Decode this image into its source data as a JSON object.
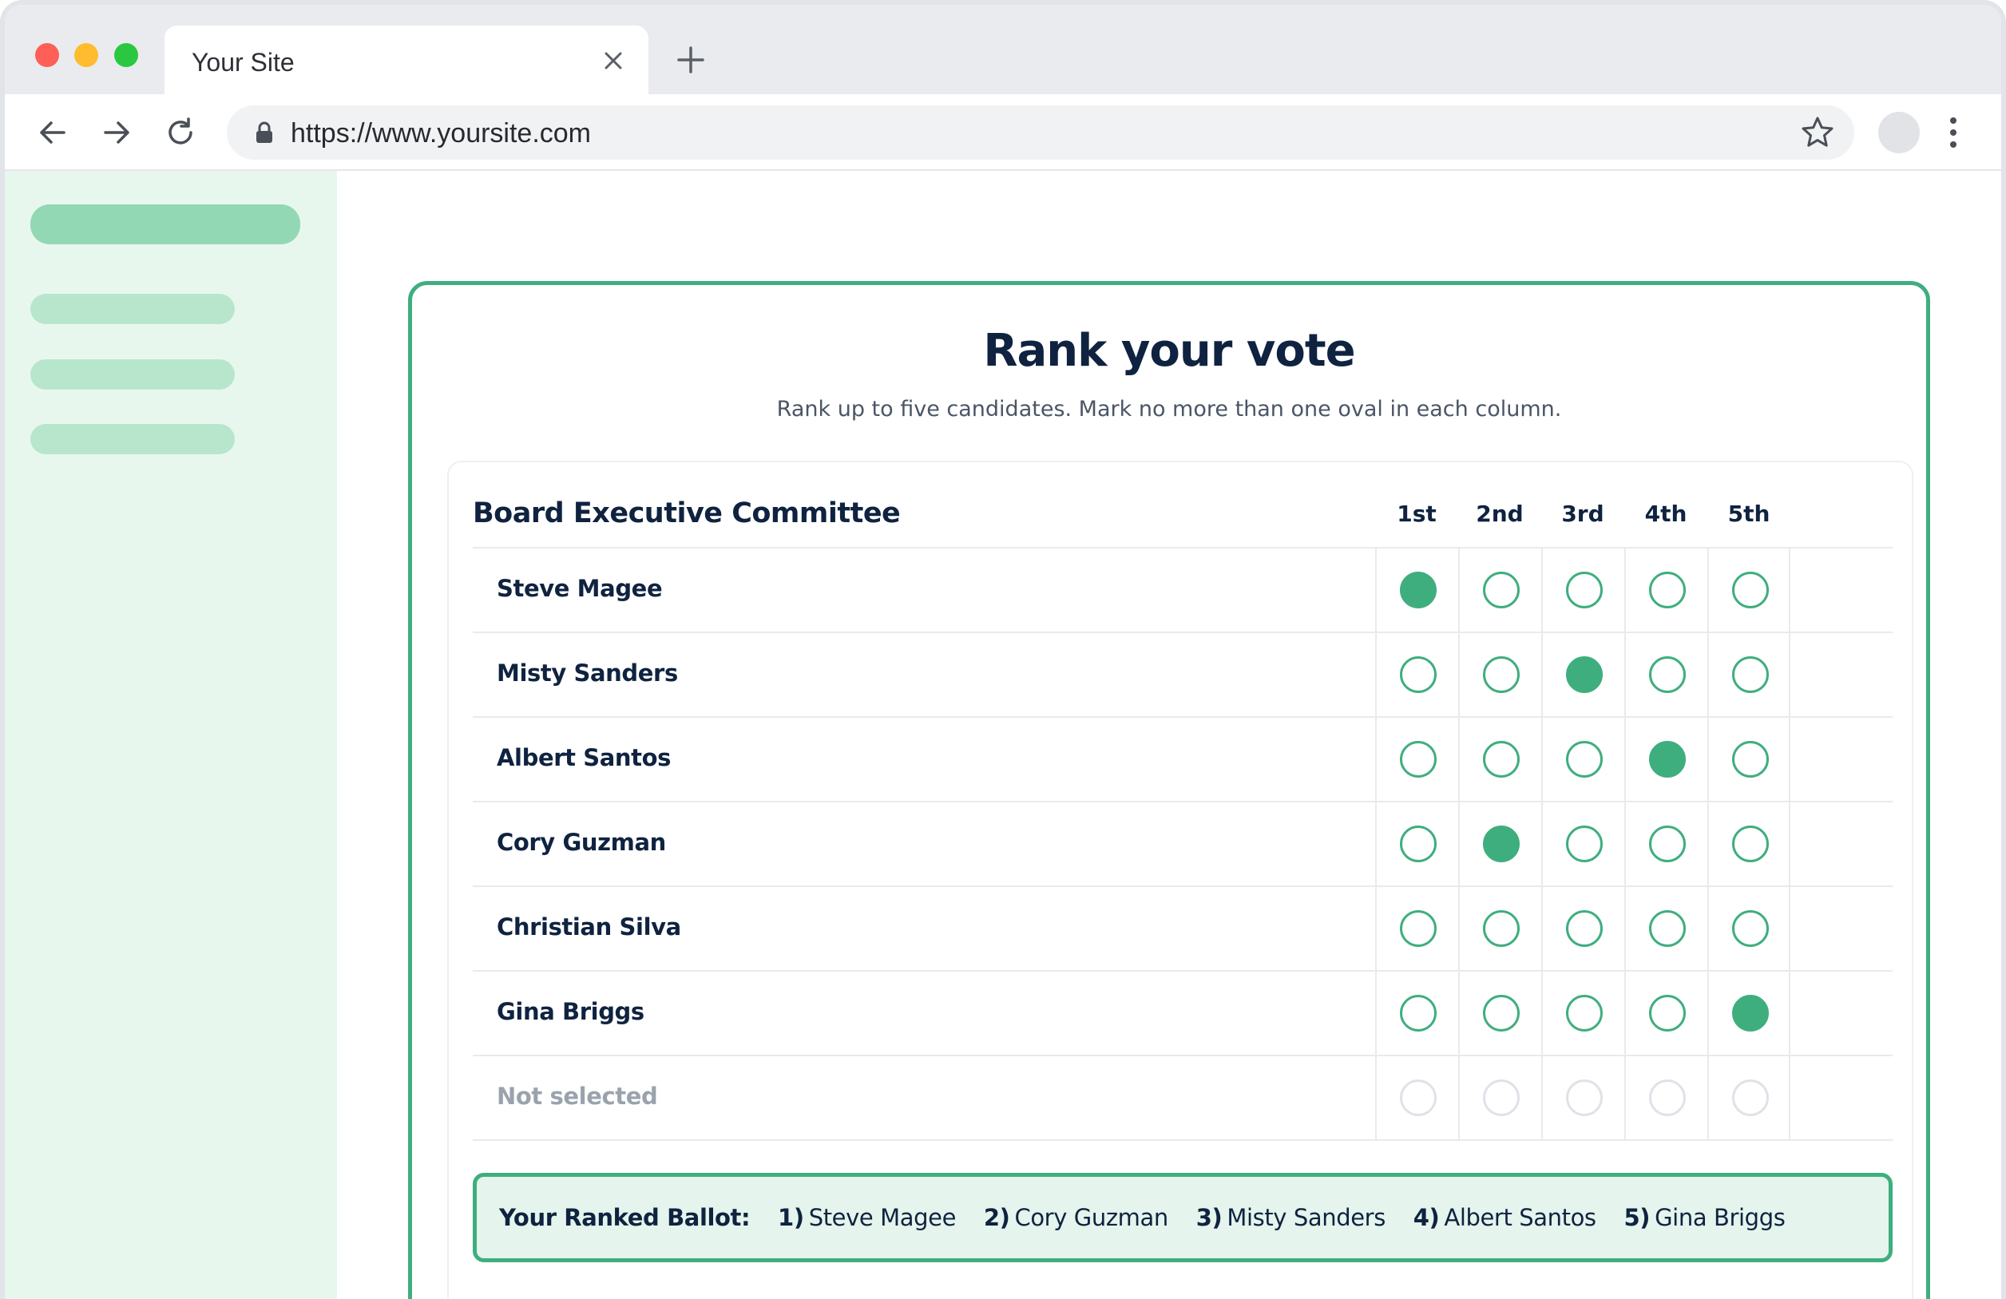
{
  "browser": {
    "tab_title": "Your Site",
    "url": "https://www.yoursite.com"
  },
  "colors": {
    "accent": "#3fae7e",
    "title": "#0f2340",
    "sidebar_bg": "#e8f7ee",
    "ballot_bg": "#e5f4ec"
  },
  "card": {
    "title": "Rank your vote",
    "subtitle": "Rank up to five candidates. Mark no more than one oval in each column."
  },
  "race": {
    "name": "Board Executive Committee",
    "ranks": [
      "1st",
      "2nd",
      "3rd",
      "4th",
      "5th"
    ],
    "candidates": [
      {
        "name": "Steve Magee",
        "selected_rank": 1
      },
      {
        "name": "Misty Sanders",
        "selected_rank": 3
      },
      {
        "name": "Albert Santos",
        "selected_rank": 4
      },
      {
        "name": "Cory Guzman",
        "selected_rank": 2
      },
      {
        "name": "Christian Silva",
        "selected_rank": 0
      },
      {
        "name": "Gina Briggs",
        "selected_rank": 5
      }
    ],
    "not_selected_label": "Not selected"
  },
  "ballot": {
    "label": "Your Ranked Ballot:",
    "items": [
      {
        "num": "1)",
        "name": "Steve Magee"
      },
      {
        "num": "2)",
        "name": "Cory Guzman"
      },
      {
        "num": "3)",
        "name": "Misty Sanders"
      },
      {
        "num": "4)",
        "name": "Albert Santos"
      },
      {
        "num": "5)",
        "name": "Gina Briggs"
      }
    ]
  }
}
